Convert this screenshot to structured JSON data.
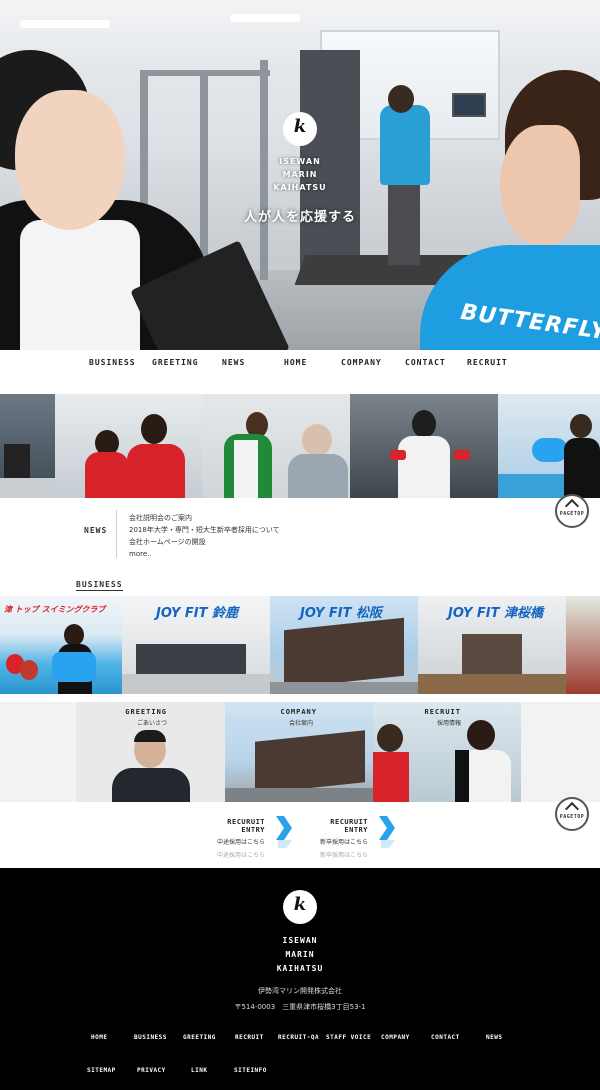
{
  "hero": {
    "brand": [
      "ISEWAN",
      "MARIN",
      "KAIHATSU"
    ],
    "logo_glyph": "k",
    "tagline": "人が人を応援する",
    "shirt_text": "BUTTERFLY"
  },
  "nav": {
    "items": [
      "BUSINESS",
      "GREETING",
      "NEWS",
      "HOME",
      "COMPANY",
      "CONTACT",
      "RECRUIT"
    ]
  },
  "news": {
    "label": "NEWS",
    "items": [
      "会社説明会のご案内",
      "2018年大学・専門・短大生新卒者採用について",
      "会社ホームページの開設",
      "more.."
    ]
  },
  "pagetop": {
    "label": "PAGETOP"
  },
  "business": {
    "title": "BUSINESS",
    "tiles": [
      "津 トップ スイミングクラブ",
      "JOY FIT 鈴鹿",
      "JOY FIT 松阪",
      "JOY FIT 津桜橋"
    ]
  },
  "cards": [
    {
      "en": "GREETING",
      "ja": "ごあいさつ"
    },
    {
      "en": "COMPANY",
      "ja": "会社案内"
    },
    {
      "en": "RECRUIT",
      "ja": "採用情報"
    }
  ],
  "recruit": [
    {
      "title": "RECURUIT ENTRY",
      "sub": "中途採用はこちら",
      "ghost": "中途採用はこちら"
    },
    {
      "title": "RECURUIT ENTRY",
      "sub": "新卒採用はこちら",
      "ghost": "新卒採用はこちら"
    }
  ],
  "footer": {
    "brand": [
      "ISEWAN",
      "MARIN",
      "KAIHATSU"
    ],
    "company": "伊勢湾マリン開発株式会社",
    "address": "〒514-0003　三重県津市桜橋3丁目53-1",
    "links_row1": [
      "HOME",
      "BUSINESS",
      "GREETING",
      "RECRUIT",
      "RECRUIT-QA",
      "STAFF VOICE",
      "COMPANY",
      "CONTACT",
      "NEWS"
    ],
    "links_row2": [
      "SITEMAP",
      "PRIVACY",
      "LINK",
      "SITEINFO"
    ]
  },
  "colors": {
    "accent_blue": "#1e9de0",
    "arrow_blue": "#2aa2ea",
    "red_uniform": "#d8232a",
    "footer_bg": "#000000"
  }
}
